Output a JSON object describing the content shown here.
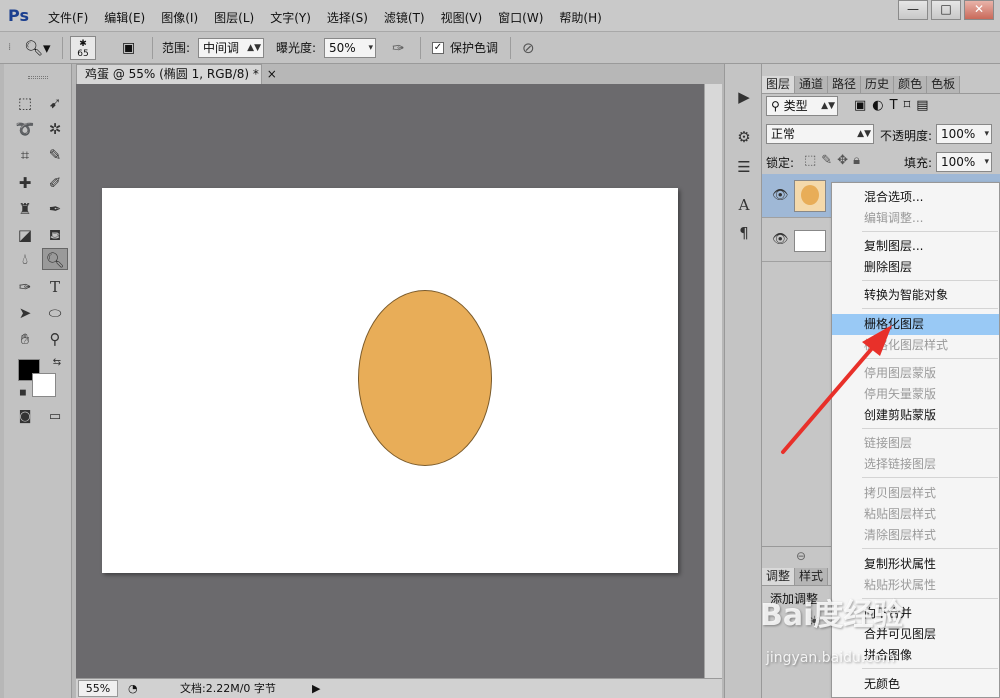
{
  "app": {
    "logo": "Ps"
  },
  "menubar": {
    "items": [
      "文件(F)",
      "编辑(E)",
      "图像(I)",
      "图层(L)",
      "文字(Y)",
      "选择(S)",
      "滤镜(T)",
      "视图(V)",
      "窗口(W)",
      "帮助(H)"
    ]
  },
  "window_controls": {
    "minimize": "—",
    "maximize": "□",
    "close": "✕"
  },
  "options": {
    "brush_size": "65",
    "range_label": "范围:",
    "range_value": "中间调",
    "exposure_label": "曝光度:",
    "exposure_value": "50%",
    "protect_tone_label": "保护色调",
    "protect_tone_checked": "✓"
  },
  "document": {
    "tab_title": "鸡蛋 @ 55% (椭圆 1, RGB/8) *",
    "tab_close": "×",
    "zoom": "55%",
    "status_text": "文档:2.22M/0 字节",
    "ellipse_color": "#e8ad58"
  },
  "layers_panel": {
    "tabs": [
      "图层",
      "通道",
      "路径",
      "历史",
      "颜色",
      "色板"
    ],
    "filter_label": "类型",
    "blend_mode": "正常",
    "opacity_label": "不透明度:",
    "opacity_value": "100%",
    "lock_label": "锁定:",
    "fill_label": "填充:",
    "fill_value": "100%"
  },
  "bottom_panel": {
    "tabs": [
      "调整",
      "样式"
    ],
    "add_adjust_label": "添加调整"
  },
  "context_menu": {
    "items": [
      {
        "label": "混合选项...",
        "disabled": false
      },
      {
        "label": "编辑调整...",
        "disabled": true
      },
      {
        "label": "复制图层...",
        "disabled": false
      },
      {
        "label": "删除图层",
        "disabled": false
      },
      {
        "label": "转换为智能对象",
        "disabled": false
      },
      {
        "label": "栅格化图层",
        "disabled": false,
        "highlighted": true
      },
      {
        "label": "栅格化图层样式",
        "disabled": true
      },
      {
        "label": "停用图层蒙版",
        "disabled": true
      },
      {
        "label": "停用矢量蒙版",
        "disabled": true
      },
      {
        "label": "创建剪贴蒙版",
        "disabled": false
      },
      {
        "label": "链接图层",
        "disabled": true
      },
      {
        "label": "选择链接图层",
        "disabled": true
      },
      {
        "label": "拷贝图层样式",
        "disabled": true
      },
      {
        "label": "粘贴图层样式",
        "disabled": true
      },
      {
        "label": "清除图层样式",
        "disabled": true
      },
      {
        "label": "复制形状属性",
        "disabled": false
      },
      {
        "label": "粘贴形状属性",
        "disabled": true
      },
      {
        "label": "向下合并",
        "disabled": false
      },
      {
        "label": "合并可见图层",
        "disabled": false
      },
      {
        "label": "拼合图像",
        "disabled": false
      },
      {
        "label": "无颜色",
        "disabled": false
      }
    ]
  },
  "watermark": {
    "text": "Bai度经验",
    "sub": "jingyan.baidu.com"
  }
}
